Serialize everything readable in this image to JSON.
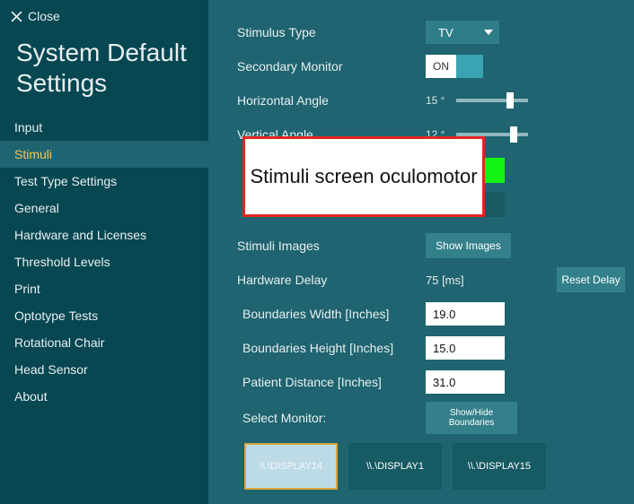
{
  "close_label": "Close",
  "title": "System Default Settings",
  "nav": {
    "items": [
      "Input",
      "Stimuli",
      "Test Type Settings",
      "General",
      "Hardware and Licenses",
      "Threshold Levels",
      "Print",
      "Optotype Tests",
      "Rotational Chair",
      "Head Sensor",
      "About"
    ],
    "active_index": 1
  },
  "fields": {
    "stimulus_type": {
      "label": "Stimulus Type",
      "value": "TV"
    },
    "secondary_monitor": {
      "label": "Secondary Monitor",
      "value": "ON"
    },
    "horizontal_angle": {
      "label": "Horizontal Angle",
      "value": "15 °",
      "slider_pct": 70
    },
    "vertical_angle": {
      "label": "Vertical Angle",
      "value": "12 °",
      "slider_pct": 75
    },
    "stimuli_images": {
      "label": "Stimuli Images",
      "button": "Show Images"
    },
    "hardware_delay": {
      "label": "Hardware Delay",
      "value": "75 [ms]",
      "reset_button": "Reset Delay"
    },
    "boundaries_width": {
      "label": "Boundaries Width   [Inches]",
      "value": "19.0"
    },
    "boundaries_height": {
      "label": "Boundaries Height   [Inches]",
      "value": "15.0"
    },
    "patient_distance": {
      "label": "Patient Distance   [Inches]",
      "value": "31.0"
    },
    "select_monitor": {
      "label": "Select Monitor:",
      "button": "Show/Hide Boundaries"
    }
  },
  "monitors": [
    {
      "name": "\\\\.\\DISPLAY14",
      "selected": true
    },
    {
      "name": "\\\\.\\DISPLAY1",
      "selected": false
    },
    {
      "name": "\\\\.\\DISPLAY15",
      "selected": false
    }
  ],
  "overlay": "Stimuli screen oculomotor",
  "colors": {
    "green_swatch": "#14f414"
  }
}
